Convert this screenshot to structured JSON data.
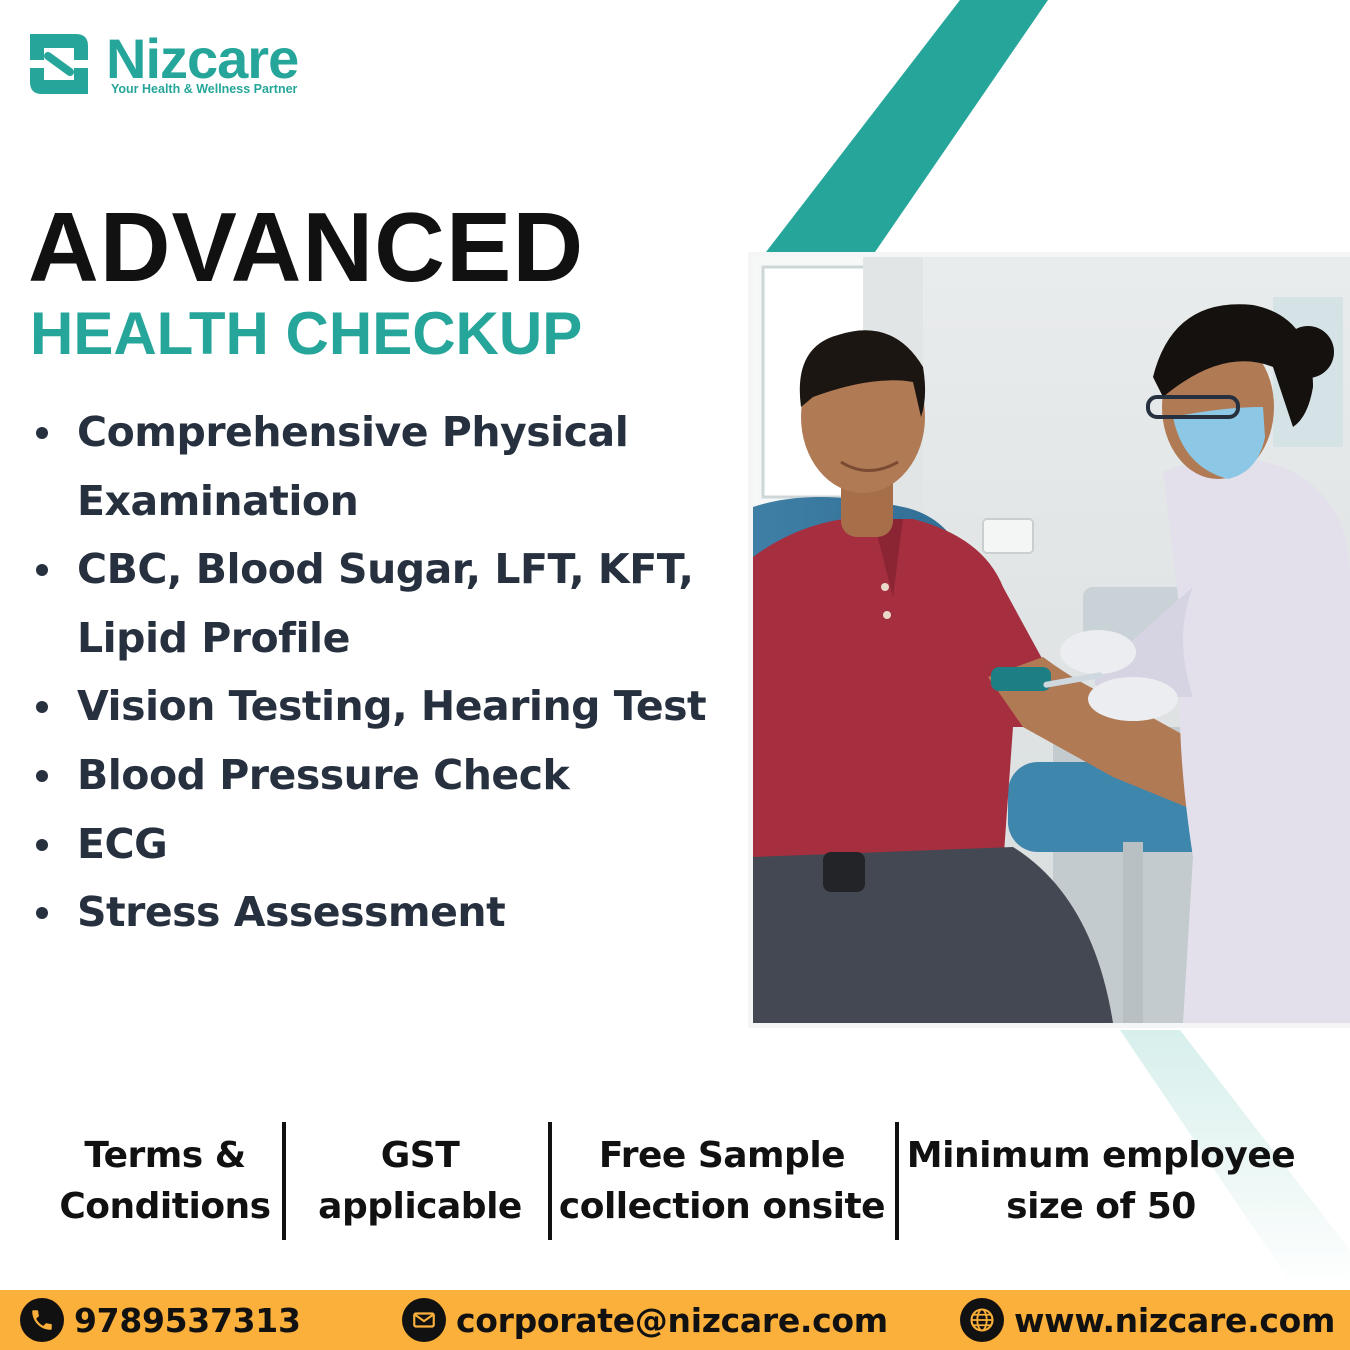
{
  "brand": {
    "name": "Nizcare",
    "tagline": "Your Health & Wellness Partner",
    "primary_color": "#26a69a",
    "accent_color": "#fbb03b",
    "logo_icon": "nizcare-logo-icon"
  },
  "headline": {
    "line1": "ADVANCED",
    "line2": "HEALTH CHECKUP"
  },
  "features": [
    "Comprehensive Physical Examination",
    "CBC, Blood Sugar, LFT, KFT, Lipid Profile",
    "Vision Testing, Hearing Test",
    "Blood Pressure Check",
    "ECG",
    "Stress Assessment"
  ],
  "photo": {
    "icon": "blood-test-photo"
  },
  "terms": [
    {
      "line1": "Terms &",
      "line2": "Conditions"
    },
    {
      "line1": "GST",
      "line2": "applicable"
    },
    {
      "line1": "Free Sample",
      "line2": "collection onsite"
    },
    {
      "line1": "Minimum employee",
      "line2": "size of 50"
    }
  ],
  "contact": {
    "phone": "9789537313",
    "email": "corporate@nizcare.com",
    "website": "www.nizcare.com",
    "phone_icon": "phone-icon",
    "email_icon": "mail-icon",
    "website_icon": "globe-icon"
  }
}
